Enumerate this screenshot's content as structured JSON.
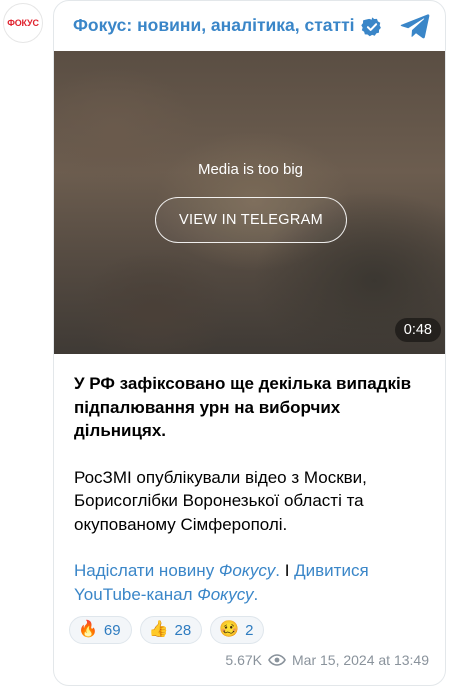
{
  "avatar": {
    "text": "ФОКУС"
  },
  "header": {
    "title": "Фокус: новини, аналітика, статті"
  },
  "media": {
    "message": "Media is too big",
    "button_label": "VIEW IN TELEGRAM",
    "duration": "0:48"
  },
  "post": {
    "headline": "У РФ зафіксовано ще декілька випадків підпалювання урн на виборчих дільницях.",
    "paragraph": "РосЗМІ опублікували відео з Москви, Борисоглібки Воронезької області та окупованому Сімферополі.",
    "link1_prefix": "Надіслати новину ",
    "link1_italic": "Фокусу",
    "link1_suffix": ".",
    "separator": " I ",
    "link2_prefix": "Дивитися YouTube-канал ",
    "link2_italic": "Фокусу",
    "link2_suffix": "."
  },
  "reactions": [
    {
      "emoji": "🔥",
      "count": "69"
    },
    {
      "emoji": "👍",
      "count": "28"
    },
    {
      "emoji": "🥴",
      "count": "2"
    }
  ],
  "footer": {
    "views": "5.67K",
    "date": "Mar 15, 2024 at 13:49"
  },
  "colors": {
    "accent": "#3a86c8",
    "brand_red": "#e0222e",
    "muted": "#8a939c"
  }
}
